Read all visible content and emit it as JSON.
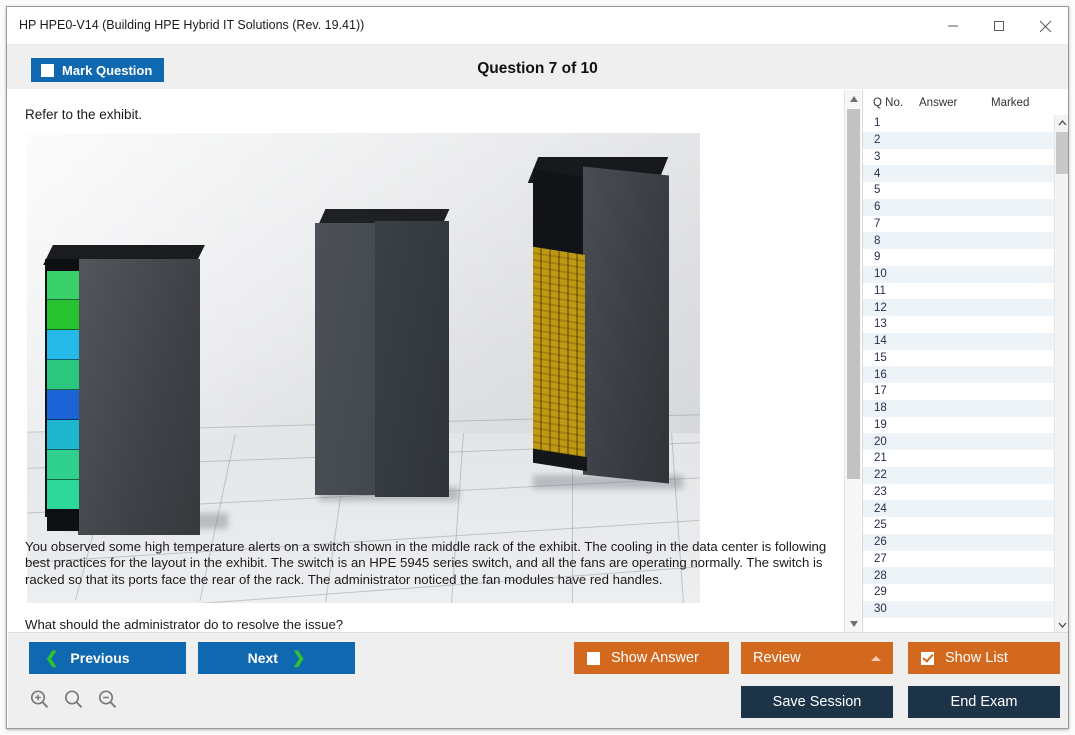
{
  "window": {
    "title": "HP HPE0-V14 (Building HPE Hybrid IT Solutions (Rev. 19.41))",
    "minimize_label": "minimize",
    "maximize_label": "maximize",
    "close_label": "close"
  },
  "header": {
    "mark_question_label": "Mark Question",
    "mark_question_checked": false,
    "question_title": "Question 7 of 10"
  },
  "question": {
    "refer_text": "Refer to the exhibit.",
    "body": "You observed some high temperature alerts on a switch shown in the middle rack of the exhibit. The cooling in the data center is following best practices for the layout in the exhibit. The switch is an HPE 5945 series switch, and all the fans are operating normally. The switch is racked so that its ports face the rear of the rack. The administrator noticed the fan modules have red handles.",
    "prompt": "What should the administrator do to resolve the issue?",
    "exhibit_alt": "Photo of three data center racks on a tiled floor: left rack with green, cyan and blue colored modules on its front face; middle rack plain dark gray; right rack with yellow/gold panels on its front face."
  },
  "list": {
    "columns": [
      "Q No.",
      "Answer",
      "Marked"
    ],
    "rows": [
      {
        "no": "1",
        "answer": "",
        "marked": ""
      },
      {
        "no": "2",
        "answer": "",
        "marked": ""
      },
      {
        "no": "3",
        "answer": "",
        "marked": ""
      },
      {
        "no": "4",
        "answer": "",
        "marked": ""
      },
      {
        "no": "5",
        "answer": "",
        "marked": ""
      },
      {
        "no": "6",
        "answer": "",
        "marked": ""
      },
      {
        "no": "7",
        "answer": "",
        "marked": ""
      },
      {
        "no": "8",
        "answer": "",
        "marked": ""
      },
      {
        "no": "9",
        "answer": "",
        "marked": ""
      },
      {
        "no": "10",
        "answer": "",
        "marked": ""
      },
      {
        "no": "11",
        "answer": "",
        "marked": ""
      },
      {
        "no": "12",
        "answer": "",
        "marked": ""
      },
      {
        "no": "13",
        "answer": "",
        "marked": ""
      },
      {
        "no": "14",
        "answer": "",
        "marked": ""
      },
      {
        "no": "15",
        "answer": "",
        "marked": ""
      },
      {
        "no": "16",
        "answer": "",
        "marked": ""
      },
      {
        "no": "17",
        "answer": "",
        "marked": ""
      },
      {
        "no": "18",
        "answer": "",
        "marked": ""
      },
      {
        "no": "19",
        "answer": "",
        "marked": ""
      },
      {
        "no": "20",
        "answer": "",
        "marked": ""
      },
      {
        "no": "21",
        "answer": "",
        "marked": ""
      },
      {
        "no": "22",
        "answer": "",
        "marked": ""
      },
      {
        "no": "23",
        "answer": "",
        "marked": ""
      },
      {
        "no": "24",
        "answer": "",
        "marked": ""
      },
      {
        "no": "25",
        "answer": "",
        "marked": ""
      },
      {
        "no": "26",
        "answer": "",
        "marked": ""
      },
      {
        "no": "27",
        "answer": "",
        "marked": ""
      },
      {
        "no": "28",
        "answer": "",
        "marked": ""
      },
      {
        "no": "29",
        "answer": "",
        "marked": ""
      },
      {
        "no": "30",
        "answer": "",
        "marked": ""
      }
    ]
  },
  "toolbar": {
    "previous_label": "Previous",
    "next_label": "Next",
    "prev_chevron": "❮",
    "next_chevron": "❯",
    "show_answer_label": "Show Answer",
    "show_answer_checked": false,
    "review_label": "Review",
    "show_list_label": "Show List",
    "show_list_checked": true,
    "save_session_label": "Save Session",
    "end_exam_label": "End Exam",
    "zoom_in_label": "Zoom In",
    "zoom_reset_label": "Zoom Reset",
    "zoom_out_label": "Zoom Out"
  },
  "colors": {
    "accent_blue": "#1068b0",
    "accent_orange": "#d2691e",
    "navy": "#1d3448",
    "chevron_green": "#2fc32f",
    "header_band": "#efefef",
    "row_alt": "#eef3f8"
  }
}
